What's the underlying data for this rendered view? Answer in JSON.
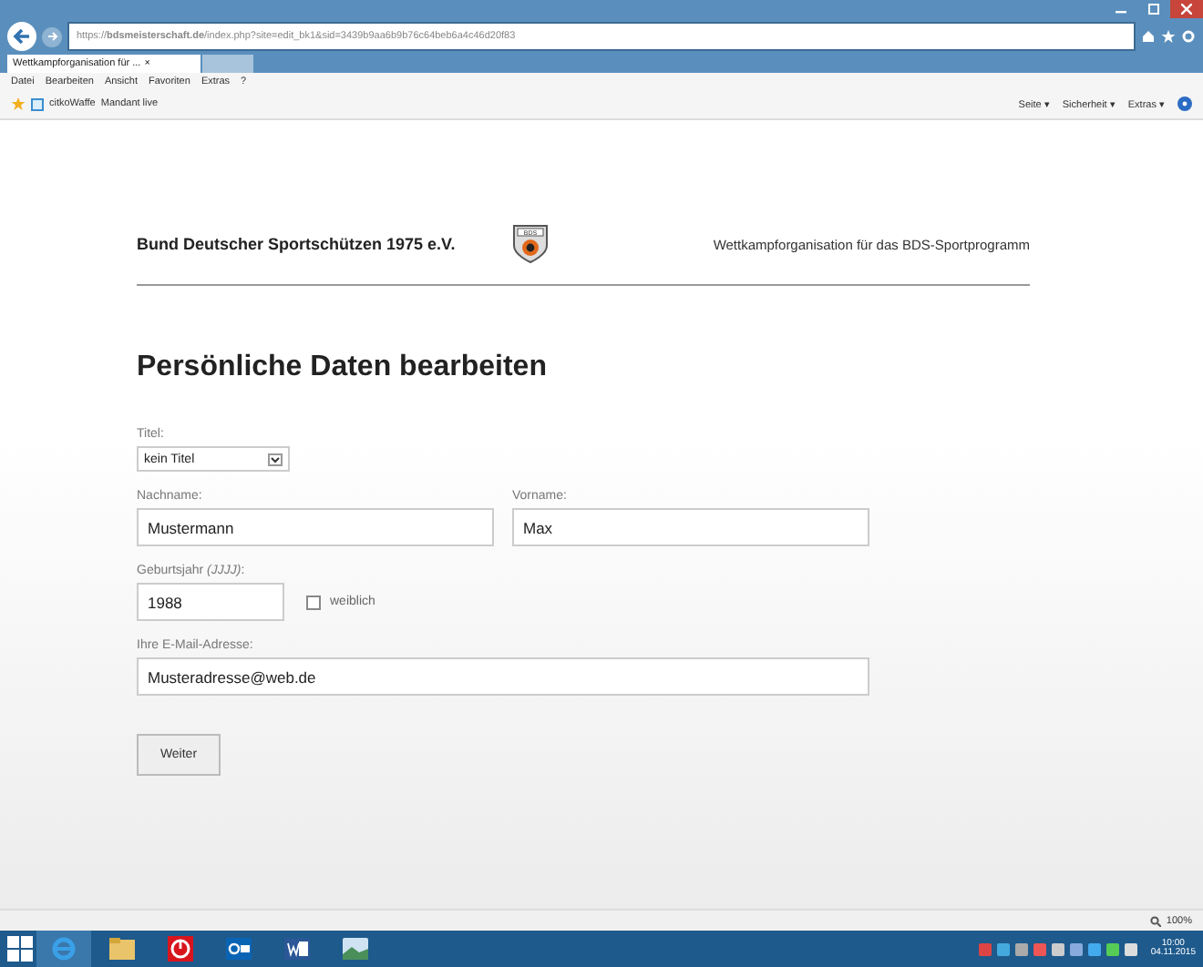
{
  "browser": {
    "url": "https://**bdsmeisterschaft.de**/index.php?site=edit_bk1&sid=3439b9aa6b9b76c64beb6a4c46d20f83",
    "tabs": [
      {
        "label": "Wettkampforganisation für ...",
        "close": "×",
        "selected": true
      }
    ],
    "menu": [
      "Datei",
      "Bearbeiten",
      "Ansicht",
      "Favoriten",
      "Extras",
      "?"
    ],
    "favorites": [
      "citkoWaffe",
      "Mandant live"
    ],
    "commands": [
      "Seite ▾",
      "Sicherheit ▾",
      "Extras ▾"
    ]
  },
  "page": {
    "organisation": "Bund Deutscher Sportschützen 1975 e.V.",
    "tagline": "Wettkampforganisation für das BDS-Sportprogramm",
    "logo_text": "BDS",
    "heading": "Persönliche Daten bearbeiten",
    "title_field": {
      "label": "Titel:",
      "value": "kein Titel"
    },
    "lastname": {
      "label": "Nachname:",
      "value": "Mustermann"
    },
    "firstname": {
      "label": "Vorname:",
      "value": "Max"
    },
    "birthyear": {
      "label": "Geburtsjahr *(JJJJ)*:",
      "value": "1988"
    },
    "female": {
      "label": "weiblich",
      "checked": false
    },
    "email": {
      "label": "Ihre E-Mail-Adresse:",
      "value": "Musteradresse@web.de"
    },
    "button": "Weiter"
  },
  "status_bar": {
    "zoom": "100%"
  },
  "taskbar": {
    "apps": [
      {
        "kind": "ie",
        "selected": true
      },
      {
        "kind": "folder",
        "selected": false
      },
      {
        "kind": "opera",
        "selected": false
      },
      {
        "kind": "outlook",
        "selected": false
      },
      {
        "kind": "word",
        "selected": false
      },
      {
        "kind": "photo",
        "selected": false
      }
    ],
    "time": "10:00",
    "date": "04.11.2015"
  }
}
